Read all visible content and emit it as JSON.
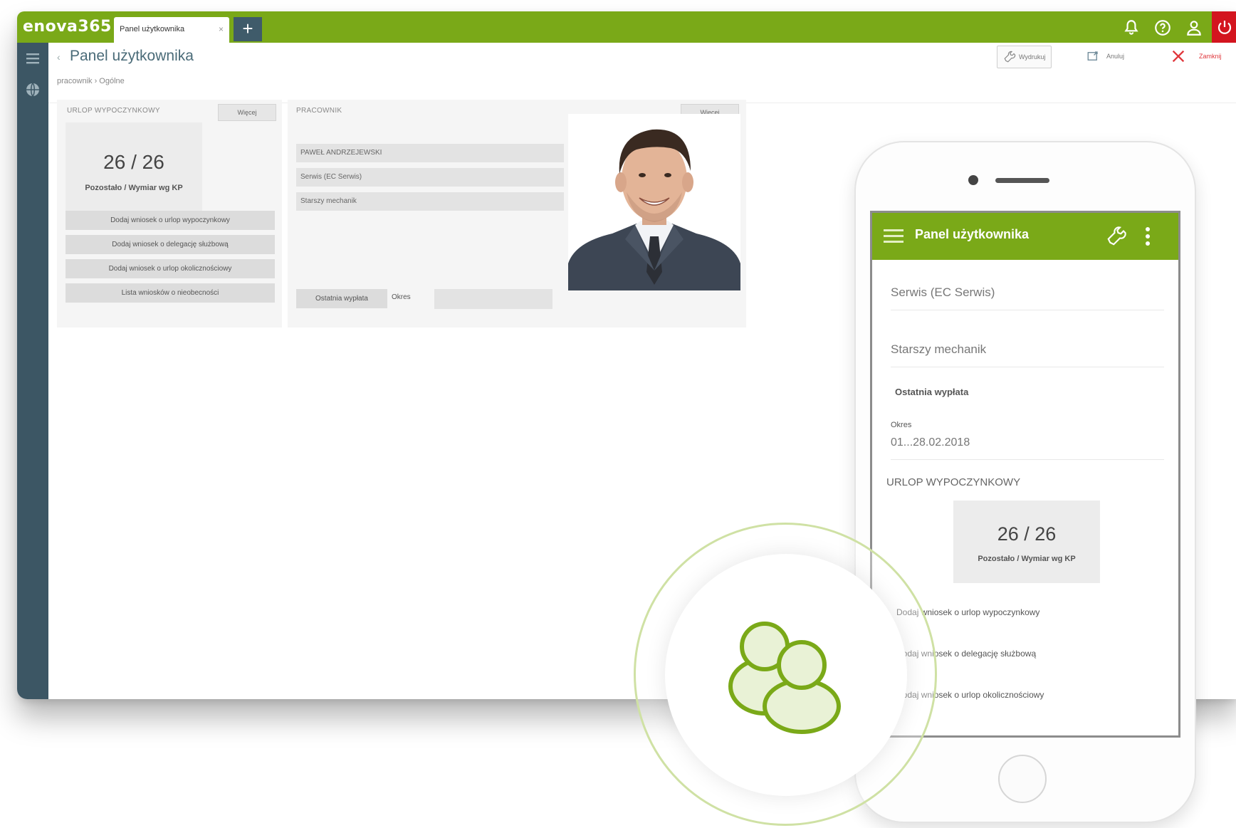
{
  "app": {
    "logo": "enova365",
    "tab_label": "Panel użytkownika",
    "tab_close": "×",
    "tab_add": "+"
  },
  "header": {
    "back": "‹",
    "title": "Panel użytkownika",
    "breadcrumb": "pracownik  ›  Ogólne",
    "actions": {
      "primary": "Wydrukuj",
      "secondary": "Anuluj",
      "close": "Zamknij"
    }
  },
  "leave_card": {
    "title": "URLOP WYPOCZYNKOWY",
    "more": "Więcej",
    "counter": "26 / 26",
    "counter_caption": "Pozostało / Wymiar wg KP",
    "buttons": [
      "Dodaj wniosek o urlop wypoczynkowy",
      "Dodaj wniosek o delegację służbową",
      "Dodaj wniosek o urlop okolicznościowy",
      "Lista wniosków o nieobecności"
    ]
  },
  "employee_card": {
    "title": "PRACOWNIK",
    "more": "Więcej",
    "fields": [
      "PAWEŁ ANDRZEJEWSKI",
      "Serwis (EC Serwis)",
      "Starszy mechanik"
    ],
    "last_payment_button": "Ostatnia wypłata",
    "period_label": "Okres",
    "period_value": ""
  },
  "phone": {
    "title": "Panel użytkownika",
    "rows": [
      "Serwis (EC Serwis)",
      "Starszy mechanik"
    ],
    "last_payment": "Ostatnia wypłata",
    "period_label": "Okres",
    "period_value": "01...28.02.2018",
    "leave_title": "URLOP WYPOCZYNKOWY",
    "counter": "26 / 26",
    "counter_caption": "Pozostało / Wymiar wg KP",
    "links": [
      "Dodaj wniosek o urlop wypoczynkowy",
      "Dodaj wniosek o delegację służbową",
      "Dodaj wniosek o urlop okolicznościowy"
    ]
  },
  "colors": {
    "brand_green": "#7aa918",
    "sidebar": "#3c5664",
    "power": "#d3151f",
    "close_red": "#e0363b"
  },
  "icons": [
    "bell-icon",
    "help-icon",
    "user-icon",
    "power-icon",
    "menu-icon",
    "globe-icon",
    "wrench-icon",
    "kebab-icon",
    "users-icon"
  ]
}
